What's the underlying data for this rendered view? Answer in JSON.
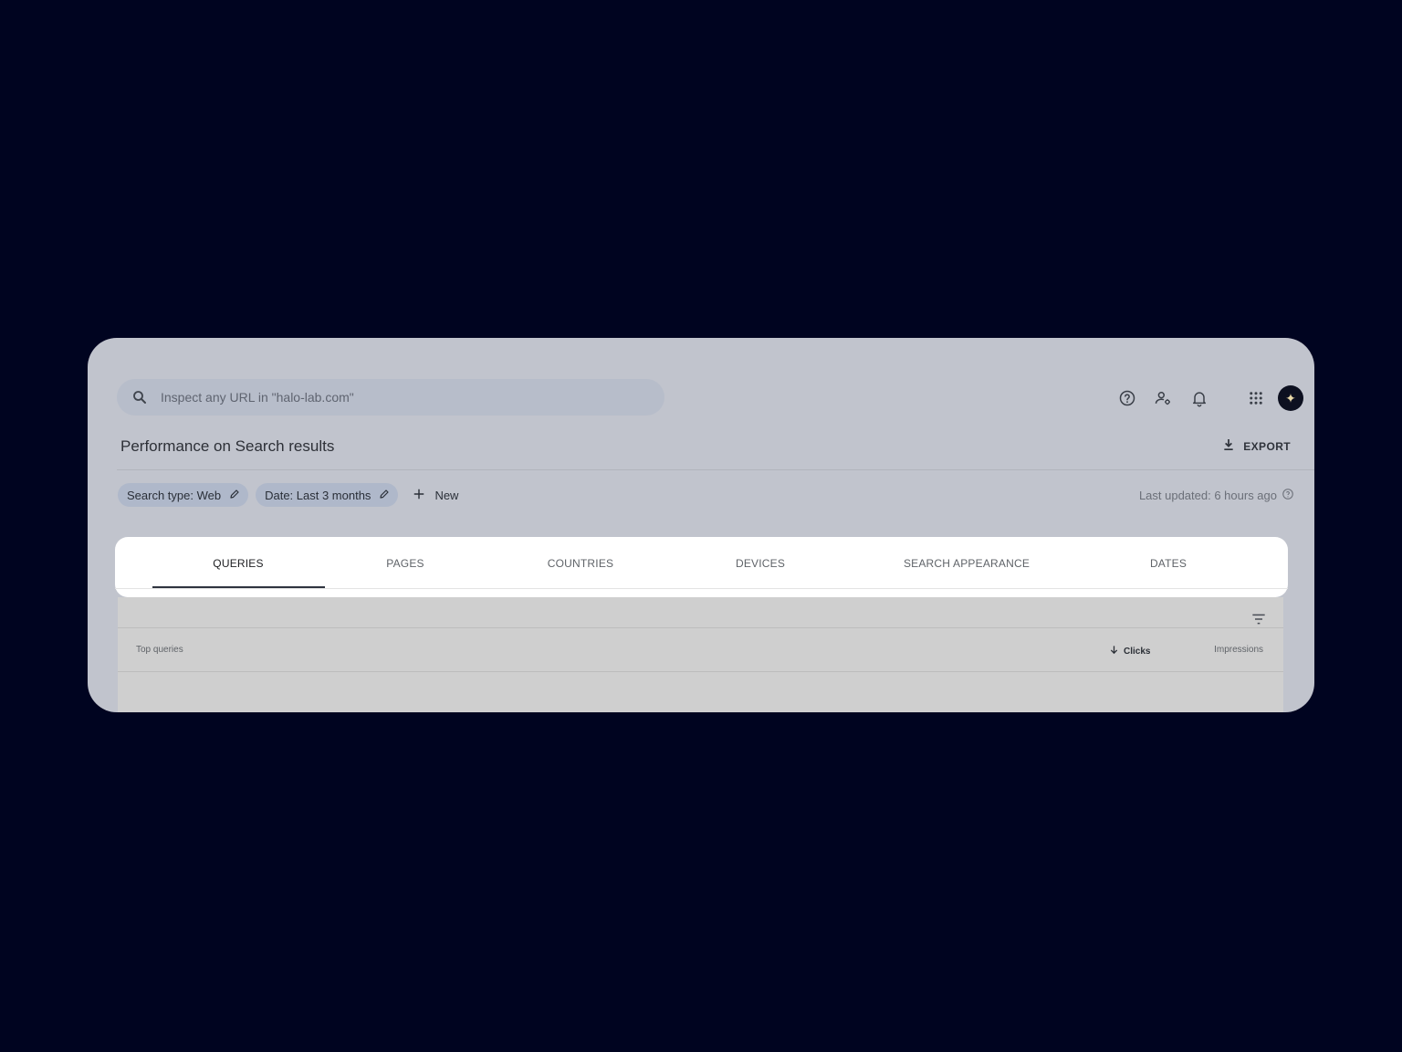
{
  "search": {
    "placeholder": "Inspect any URL in \"halo-lab.com\""
  },
  "header": {
    "icons": [
      "help-icon",
      "admin-icon",
      "bell-icon",
      "apps-icon"
    ],
    "avatar_glyph": "✦"
  },
  "page": {
    "title": "Performance on Search results",
    "export_label": "EXPORT"
  },
  "filters": {
    "chips": [
      {
        "label": "Search type: Web"
      },
      {
        "label": "Date: Last 3 months"
      }
    ],
    "new_label": "New",
    "last_updated": "Last updated: 6 hours ago"
  },
  "tabs": [
    {
      "label": "QUERIES",
      "active": true
    },
    {
      "label": "PAGES",
      "active": false
    },
    {
      "label": "COUNTRIES",
      "active": false
    },
    {
      "label": "DEVICES",
      "active": false
    },
    {
      "label": "SEARCH APPEARANCE",
      "active": false
    },
    {
      "label": "DATES",
      "active": false
    }
  ],
  "table": {
    "columns": [
      "Top queries",
      "Clicks",
      "Impressions"
    ],
    "sorted_column": "Clicks"
  },
  "colors": {
    "background": "#000420",
    "card": "#c1c4cd",
    "chip": "#afb8ca",
    "highlight": "#ffffff"
  }
}
